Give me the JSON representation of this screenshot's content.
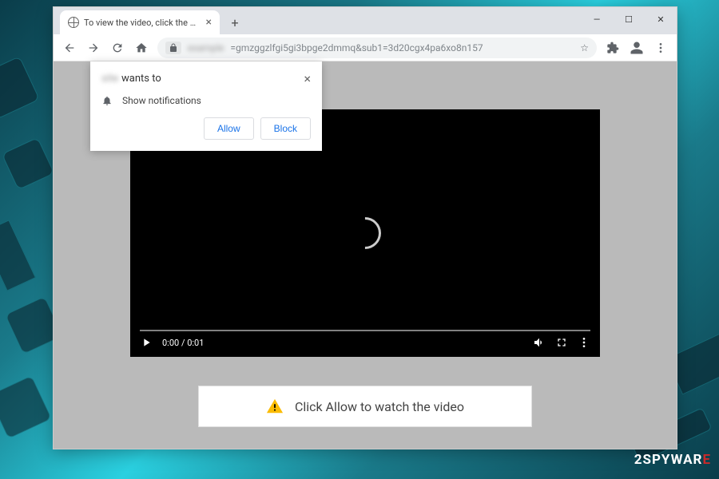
{
  "window": {
    "tab_title": "To view the video, click the Allow…",
    "minimize": "—",
    "maximize": "☐",
    "close": "✕"
  },
  "toolbar": {
    "url_prefix_hidden": "example",
    "url_visible": "=gmzggzlfgi5gi3bpge2dmmq&sub1=3d20cgx4pa6xo8n157"
  },
  "notification": {
    "origin_hidden": "site",
    "wants_to": "wants to",
    "permission_label": "Show notifications",
    "allow_label": "Allow",
    "block_label": "Block"
  },
  "video": {
    "time_display": "0:00 / 0:01"
  },
  "banner": {
    "text": "Click Allow to watch the video"
  },
  "watermark": {
    "prefix": "2SPYWAR",
    "suffix": "E"
  }
}
